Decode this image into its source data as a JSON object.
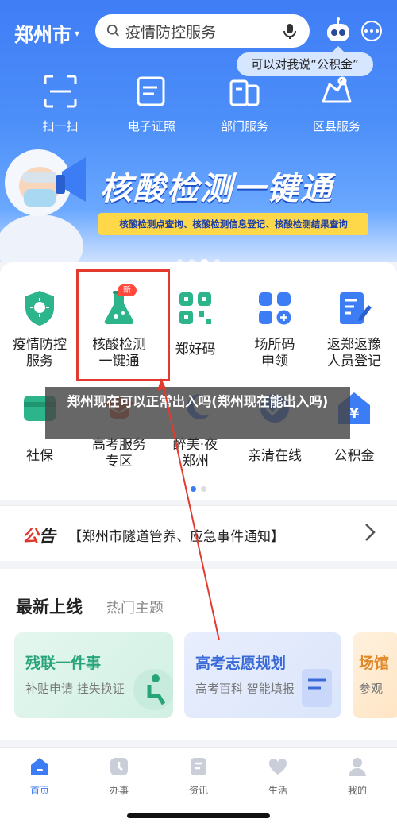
{
  "header": {
    "city": "郑州市",
    "search_placeholder": "疫情防控服务",
    "assistant_bubble": "可以对我说“公积金”"
  },
  "quick_actions": [
    {
      "label": "扫一扫",
      "icon": "scan-icon"
    },
    {
      "label": "电子证照",
      "icon": "id-card-icon"
    },
    {
      "label": "部门服务",
      "icon": "department-icon"
    },
    {
      "label": "区县服务",
      "icon": "district-icon"
    }
  ],
  "banner": {
    "title": "核酸检测一键通",
    "subtitle": "核酸检测点查询、核酸检测信息登记、核酸检测结果查询"
  },
  "services": [
    {
      "label": "疫情防控\n服务",
      "icon": "virus-shield-icon",
      "color": "#2cb48a"
    },
    {
      "label": "核酸检测\n一键通",
      "icon": "flask-icon",
      "color": "#2cb48a",
      "badge": "新"
    },
    {
      "label": "郑好码",
      "icon": "qr-code-icon",
      "color": "#2cb48a"
    },
    {
      "label": "场所码\n申领",
      "icon": "grid-add-icon",
      "color": "#3c7cf4"
    },
    {
      "label": "返郑返豫\n人员登记",
      "icon": "form-edit-icon",
      "color": "#3c7cf4"
    },
    {
      "label": "社保",
      "icon": "social-security-icon",
      "color": "#2cb48a"
    },
    {
      "label": "高考服务\n专区",
      "icon": "exam-icon",
      "color": "#e35a3a"
    },
    {
      "label": "醉美·夜\n郑州",
      "icon": "night-icon",
      "color": "#3c7cf4"
    },
    {
      "label": "亲清在线",
      "icon": "online-icon",
      "color": "#3c7cf4"
    },
    {
      "label": "公积金",
      "icon": "housing-fund-icon",
      "color": "#3c7cf4"
    }
  ],
  "overlay_caption": "郑州现在可以正常出入吗(郑州现在能出入吗)",
  "notice": {
    "tag_a": "公",
    "tag_b": "告",
    "text": "【郑州市隧道管养、应急事件通知】"
  },
  "latest": {
    "tab_active": "最新上线",
    "tab_other": "热门主题",
    "cards": [
      {
        "title": "残联一件事",
        "subtitle": "补贴申请 挂失换证"
      },
      {
        "title": "高考志愿规划",
        "subtitle": "高考百科 智能填报"
      },
      {
        "title": "场馆",
        "subtitle": "参观"
      }
    ]
  },
  "nav": [
    {
      "label": "首页",
      "icon": "home-icon",
      "active": true
    },
    {
      "label": "办事",
      "icon": "clock-icon"
    },
    {
      "label": "资讯",
      "icon": "news-icon"
    },
    {
      "label": "生活",
      "icon": "heart-icon"
    },
    {
      "label": "我的",
      "icon": "user-icon"
    }
  ],
  "colors": {
    "brand": "#3c7cf4",
    "accent_red": "#e23a2e",
    "green": "#2cb48a"
  }
}
